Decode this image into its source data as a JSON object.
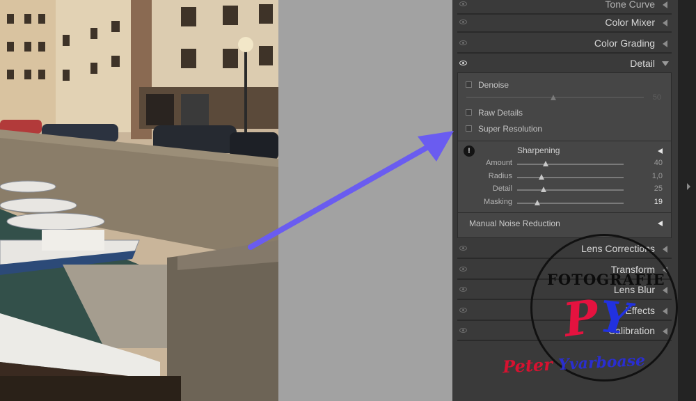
{
  "panel": {
    "sections_top": [
      {
        "title": "Tone Curve"
      },
      {
        "title": "Color Mixer"
      },
      {
        "title": "Color Grading"
      }
    ],
    "detail": {
      "title": "Detail",
      "denoise": {
        "label": "Denoise",
        "value": "50"
      },
      "raw_details": {
        "label": "Raw Details"
      },
      "super_resolution": {
        "label": "Super Resolution"
      },
      "sharpening": {
        "title": "Sharpening",
        "warning_icon": "!",
        "sliders": [
          {
            "label": "Amount",
            "value": "40",
            "level": 0.27
          },
          {
            "label": "Radius",
            "value": "1,0",
            "level": 0.23
          },
          {
            "label": "Detail",
            "value": "25",
            "level": 0.25
          },
          {
            "label": "Masking",
            "value": "19",
            "level": 0.19
          }
        ]
      },
      "manual_noise_reduction": {
        "label": "Manual Noise Reduction"
      }
    },
    "sections_bottom": [
      {
        "title": "Lens Corrections"
      },
      {
        "title": "Transform"
      },
      {
        "title": "Lens Blur"
      },
      {
        "title": "Effects"
      },
      {
        "title": "Calibration"
      }
    ]
  },
  "watermark": {
    "ring_text": "FOTOGRAFIE",
    "letter_1": "P",
    "letter_2": "Y",
    "signature_first": "Peter",
    "signature_last": "Yvarboase"
  },
  "colors": {
    "annotation_arrow": "#6a5cf0",
    "panel_bg": "#3a3a3a",
    "detail_box_bg": "#464646"
  },
  "icons": [
    "eye-icon",
    "triangle-collapse-icon",
    "triangle-expand-icon",
    "warning-icon",
    "arrow-annotation"
  ]
}
